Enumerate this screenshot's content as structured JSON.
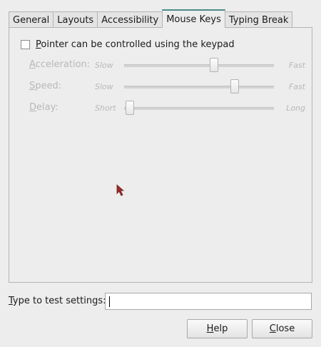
{
  "tabs": [
    {
      "label": "General"
    },
    {
      "label": "Layouts"
    },
    {
      "label": "Accessibility"
    },
    {
      "label": "Mouse Keys",
      "active": true
    },
    {
      "label": "Typing Break"
    }
  ],
  "pointer_checkbox": {
    "label_first": "P",
    "label_rest": "ointer can be controlled using the keypad",
    "checked": false
  },
  "sliders": [
    {
      "label_first": "A",
      "label_rest": "cceleration:",
      "min_label": "Slow",
      "max_label": "Fast",
      "value_fraction": 0.6,
      "enabled": false
    },
    {
      "label_first": "S",
      "label_rest": "peed:",
      "min_label": "Slow",
      "max_label": "Fast",
      "value_fraction": 0.74,
      "enabled": false
    },
    {
      "label_first": "D",
      "label_rest": "elay:",
      "min_label": "Short",
      "max_label": "Long",
      "value_fraction": 0.04,
      "enabled": false
    }
  ],
  "test_settings": {
    "label_first": "T",
    "label_rest": "ype to test settings:",
    "value": ""
  },
  "buttons": {
    "help_first": "H",
    "help_rest": "elp",
    "close_first": "C",
    "close_rest": "lose"
  },
  "icons": {
    "cursor": "mouse-pointer-icon"
  },
  "colors": {
    "active_tab_accent": "#4a8a8a",
    "disabled_text": "#b8b8b8",
    "cursor": "#9b2b2b"
  }
}
